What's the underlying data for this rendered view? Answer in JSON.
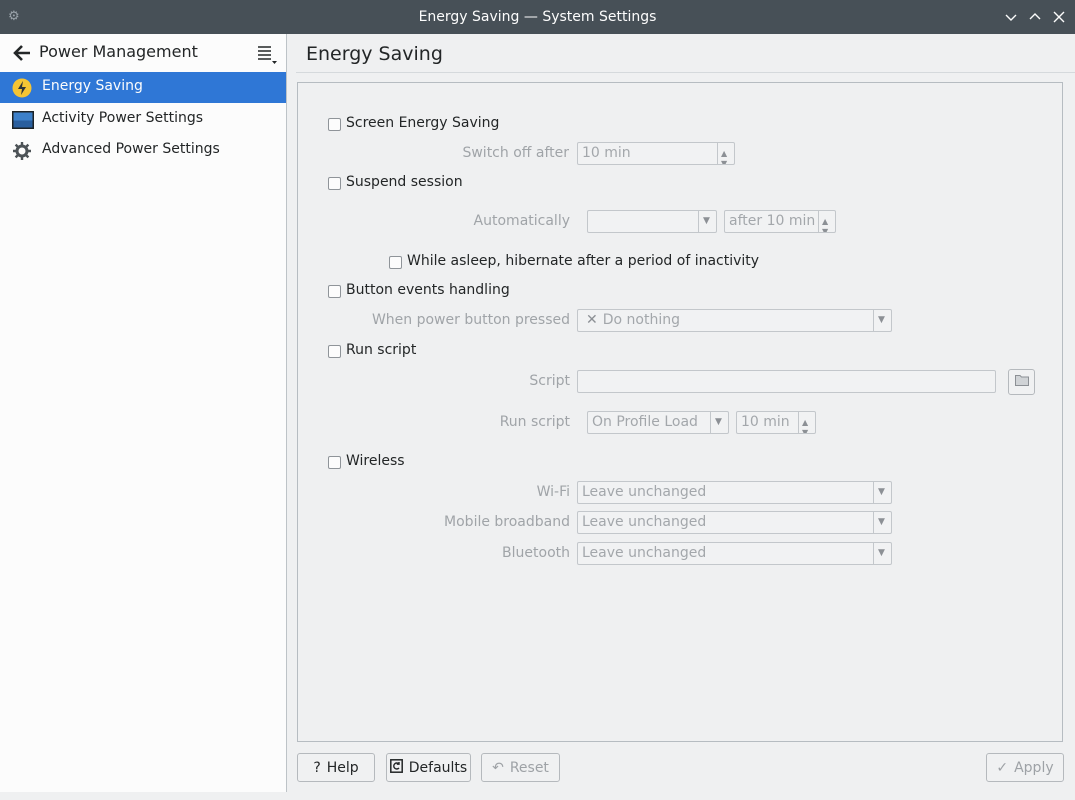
{
  "window": {
    "title": "Energy Saving — System Settings"
  },
  "sidebar": {
    "title": "Power Management",
    "items": [
      {
        "label": "Energy Saving"
      },
      {
        "label": "Activity Power Settings"
      },
      {
        "label": "Advanced Power Settings"
      }
    ]
  },
  "main": {
    "title": "Energy Saving",
    "screen": {
      "label": "Screen Energy Saving",
      "switch_label": "Switch off after",
      "switch_value": "10 min"
    },
    "suspend": {
      "label": "Suspend session",
      "auto_label": "Automatically",
      "auto_value": "",
      "after_value": "after 10 min",
      "hibernate_label": "While asleep, hibernate after a period of inactivity"
    },
    "buttons": {
      "label": "Button events handling",
      "power_label": "When power button pressed",
      "power_value": "Do nothing"
    },
    "script": {
      "label": "Run script",
      "script_label": "Script",
      "script_value": "",
      "run_label": "Run script",
      "run_value": "On Profile Load",
      "run_time": "10 min"
    },
    "wireless": {
      "label": "Wireless",
      "wifi_label": "Wi-Fi",
      "wifi_value": "Leave unchanged",
      "mobile_label": "Mobile broadband",
      "mobile_value": "Leave unchanged",
      "bt_label": "Bluetooth",
      "bt_value": "Leave unchanged"
    }
  },
  "footer": {
    "help": "Help",
    "defaults": "Defaults",
    "reset": "Reset",
    "apply": "Apply"
  },
  "colors": {
    "accent": "#2f77d6",
    "titlebar": "#475057"
  }
}
